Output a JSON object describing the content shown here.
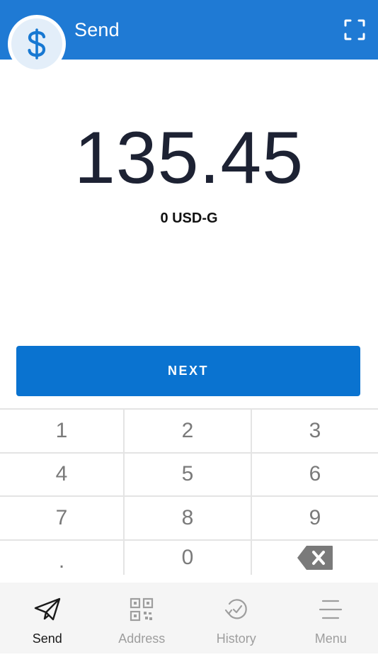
{
  "header": {
    "title": "Send",
    "avatar_icon": "dollar-icon",
    "scan_icon": "scan-frame-icon",
    "accent": "#1f7ad4"
  },
  "amount": {
    "value": "135.45",
    "currency_line": "0 USD-G"
  },
  "next_label": "NEXT",
  "keypad": {
    "rows": [
      [
        "1",
        "2",
        "3"
      ],
      [
        "4",
        "5",
        "6"
      ],
      [
        "7",
        "8",
        "9"
      ],
      [
        ".",
        "0",
        "backspace"
      ]
    ]
  },
  "nav": {
    "items": [
      {
        "label": "Send",
        "icon": "send-icon",
        "active": true
      },
      {
        "label": "Address",
        "icon": "qr-code-icon",
        "active": false
      },
      {
        "label": "History",
        "icon": "history-icon",
        "active": false
      },
      {
        "label": "Menu",
        "icon": "menu-icon",
        "active": false
      }
    ]
  },
  "colors": {
    "primary_button": "#0a73d0",
    "amount_text": "#1d2233",
    "keypad_text": "#7a7a7a",
    "nav_bg": "#f5f5f5"
  }
}
